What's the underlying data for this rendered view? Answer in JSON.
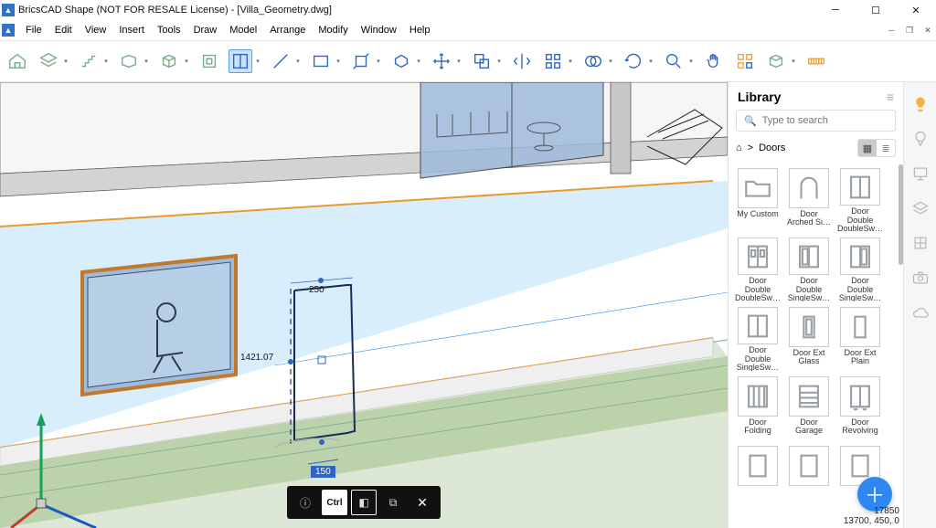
{
  "window": {
    "title": "BricsCAD Shape (NOT FOR RESALE License) - [Villa_Geometry.dwg]"
  },
  "menu": [
    "File",
    "Edit",
    "View",
    "Insert",
    "Tools",
    "Draw",
    "Model",
    "Arrange",
    "Modify",
    "Window",
    "Help"
  ],
  "toolbar_icons": [
    "home",
    "layers",
    "stairs",
    "slab",
    "box",
    "push",
    "section",
    "line",
    "rectangle",
    "pushpull",
    "extrude",
    "move",
    "copy",
    "mirror",
    "array",
    "union",
    "rotate",
    "zoom",
    "pan",
    "select-similar",
    "materials",
    "measure"
  ],
  "right_strip": [
    "idea",
    "balloon",
    "present",
    "layers",
    "model",
    "camera",
    "cloud"
  ],
  "library": {
    "title": "Library",
    "search_placeholder": "Type to search",
    "breadcrumb_root": "⌂",
    "breadcrumb_sep": ">",
    "breadcrumb_current": "Doors",
    "items": [
      {
        "label": "My Custom",
        "icon": "folder"
      },
      {
        "label": "Door Arched Si…",
        "icon": "arch"
      },
      {
        "label": "Door Double DoubleSw…",
        "icon": "dd"
      },
      {
        "label": "Door Double DoubleSw…",
        "icon": "dd2"
      },
      {
        "label": "Door Double SingleSw…",
        "icon": "ds"
      },
      {
        "label": "Door Double SingleSw…",
        "icon": "ds2"
      },
      {
        "label": "Door Double SingleSw…",
        "icon": "ds3"
      },
      {
        "label": "Door Ext Glass",
        "icon": "glass"
      },
      {
        "label": "Door Ext Plain",
        "icon": "plain"
      },
      {
        "label": "Door Folding",
        "icon": "fold"
      },
      {
        "label": "Door Garage",
        "icon": "garage"
      },
      {
        "label": "Door Revolving",
        "icon": "rev"
      },
      {
        "label": "",
        "icon": "blank"
      },
      {
        "label": "",
        "icon": "blank"
      },
      {
        "label": "",
        "icon": "blank"
      }
    ]
  },
  "scene": {
    "dim_h": "250",
    "dim_v": "1421.07",
    "dim_base": "150"
  },
  "hud": {
    "ctrl": "Ctrl"
  },
  "status": {
    "line1": "17850",
    "line2": "13700, 450, 0"
  }
}
